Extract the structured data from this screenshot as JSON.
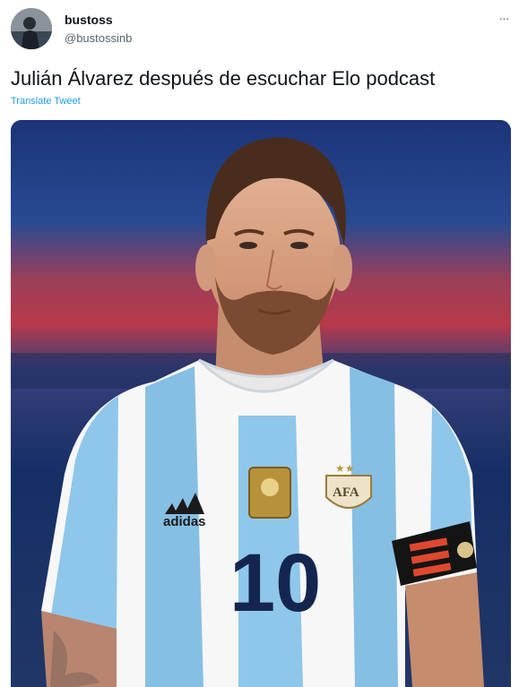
{
  "user": {
    "display_name": "bustoss",
    "handle": "@bustossinb",
    "avatar_icon": "profile-avatar"
  },
  "menu_icon": "more-dots-icon",
  "menu_glyph": "···",
  "tweet": {
    "text": "Julián Álvarez después de escuchar Elo podcast",
    "translate_label": "Translate Tweet"
  },
  "media": {
    "description_icon": "photo-footballer",
    "shirt_brand": "adidas",
    "shirt_number": "10",
    "crest_text": "AFA"
  },
  "colors": {
    "link": "#1d9bf0",
    "text": "#0f1419",
    "muted": "#536471",
    "jersey_stripe": "#7fbfe6",
    "background_blue": "#1e3a7a",
    "background_red": "#b8394a"
  }
}
